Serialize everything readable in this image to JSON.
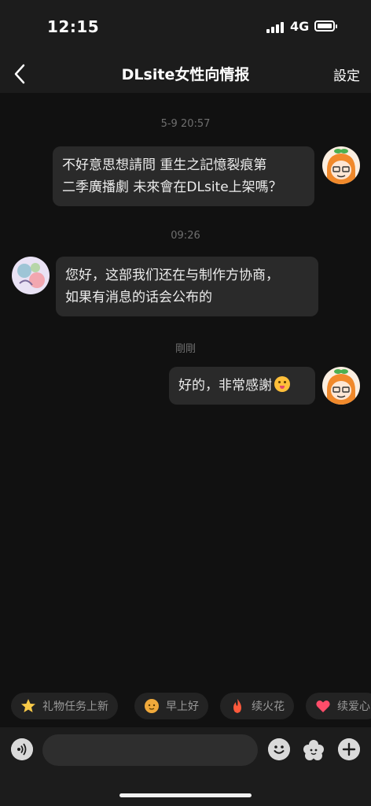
{
  "status": {
    "time": "12:15",
    "network": "4G"
  },
  "header": {
    "title": "DLsite女性向情报",
    "settings_label": "設定"
  },
  "messages": [
    {
      "timestamp": "5-9 20:57",
      "side": "right",
      "lines": [
        "不好意思想請問 重生之記憶裂痕第",
        "二季廣播劇 未來會在DLsite上架嗎？"
      ]
    },
    {
      "timestamp": "09:26",
      "side": "left",
      "lines": [
        "您好，这部我们还在与制作方协商，",
        "如果有消息的话会公布的"
      ]
    },
    {
      "timestamp": "剛剛",
      "side": "right",
      "lines": [
        "好的，非常感謝"
      ]
    }
  ],
  "quick_replies": [
    {
      "label": "礼物任务上新",
      "icon": "star-icon",
      "color": "#f7c948"
    },
    {
      "label": "早上好",
      "icon": "sun-face-icon",
      "color": "#f0a93b"
    },
    {
      "label": "续火花",
      "icon": "fire-icon",
      "color": "#ff5a3c"
    },
    {
      "label": "续爱心",
      "icon": "heart-icon",
      "color": "#ff4d6a"
    }
  ],
  "composer": {
    "placeholder": ""
  }
}
